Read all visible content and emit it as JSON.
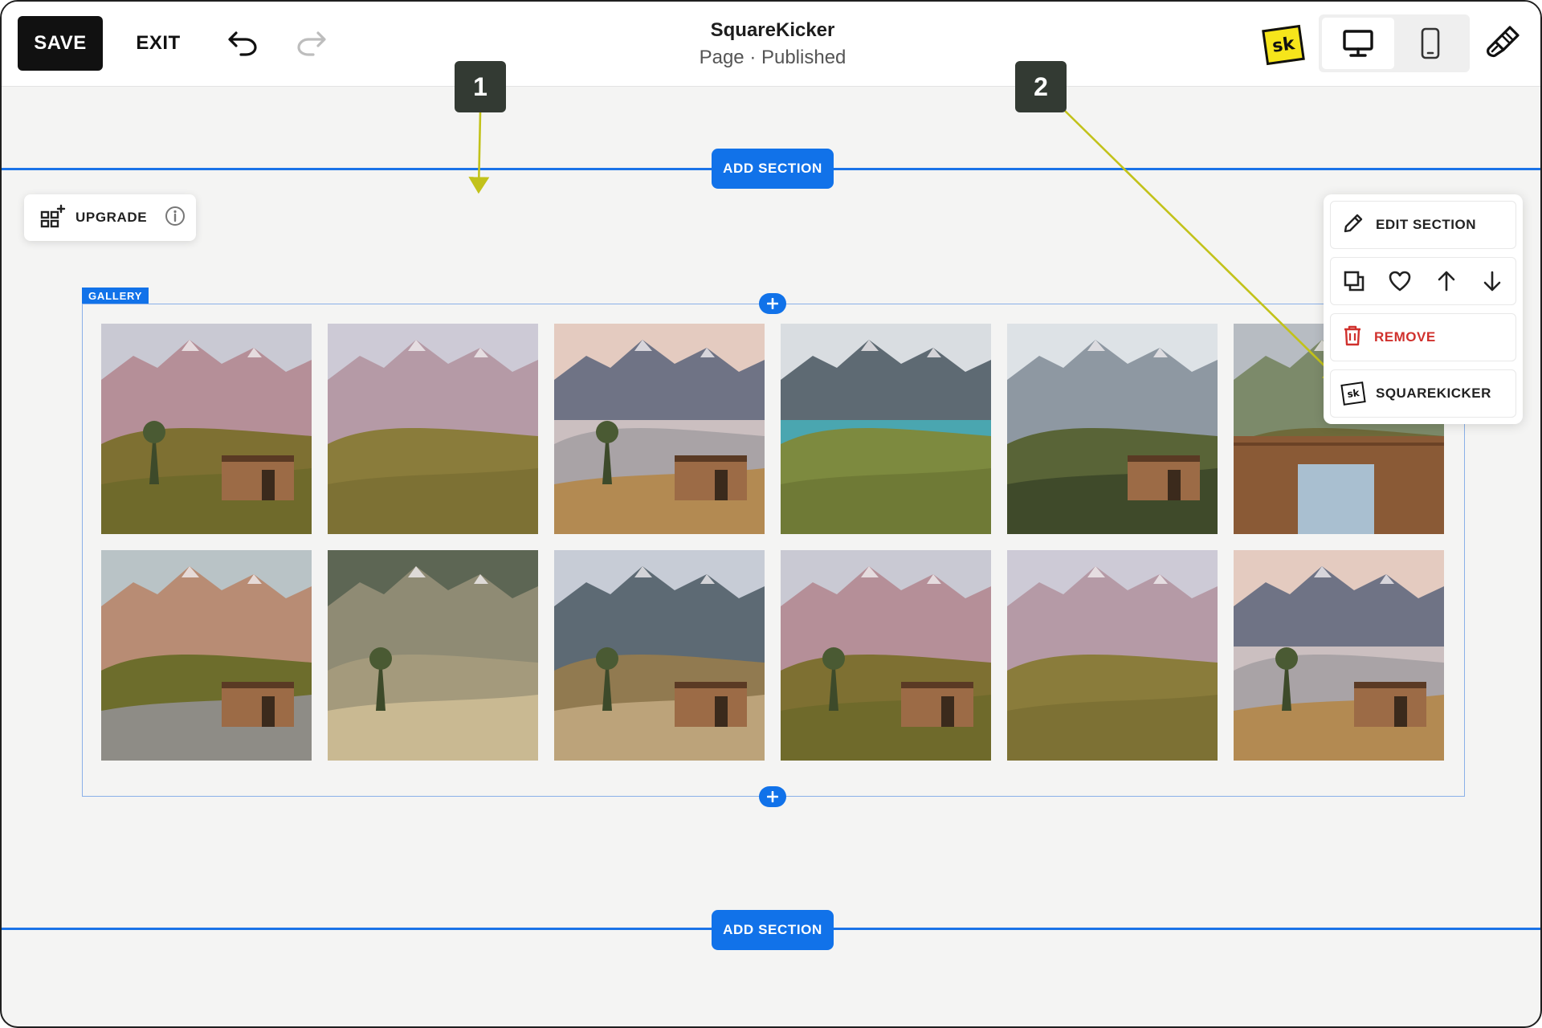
{
  "toolbar": {
    "save_label": "SAVE",
    "exit_label": "EXIT",
    "site_title": "SquareKicker",
    "page_status": "Page · Published",
    "logo_text": "sk",
    "icons": [
      "undo-icon",
      "redo-icon",
      "desktop-icon",
      "mobile-icon",
      "style-brush-icon"
    ]
  },
  "canvas": {
    "add_section_top": "ADD SECTION",
    "add_section_bottom": "ADD SECTION",
    "upgrade_label": "UPGRADE",
    "gallery_tag": "GALLERY",
    "gallery_images": [
      {
        "row": 1,
        "scene": "hillside-cabin"
      },
      {
        "row": 1,
        "scene": "mountain-peaks"
      },
      {
        "row": 1,
        "scene": "lake-cabin"
      },
      {
        "row": 1,
        "scene": "turquoise-lake"
      },
      {
        "row": 1,
        "scene": "snowy-range"
      },
      {
        "row": 1,
        "scene": "cabin-window"
      },
      {
        "row": 2,
        "scene": "cabin-stone-steps"
      },
      {
        "row": 2,
        "scene": "grassy-slope"
      },
      {
        "row": 2,
        "scene": "cabin-meadow"
      },
      {
        "row": 2,
        "scene": "hillside-cabin"
      },
      {
        "row": 2,
        "scene": "mountain-peaks"
      },
      {
        "row": 2,
        "scene": "lake-cabin"
      }
    ]
  },
  "callouts": {
    "one": "1",
    "two": "2",
    "color": "#c2c21a"
  },
  "section_menu": {
    "edit_label": "EDIT SECTION",
    "remove_label": "REMOVE",
    "squarekicker_label": "SQUAREKICKER",
    "sk_badge": "sk",
    "action_icons": [
      "duplicate-icon",
      "heart-icon",
      "arrow-up-icon",
      "arrow-down-icon"
    ]
  },
  "colors": {
    "accent": "#1172e9",
    "remove": "#d0312d",
    "logo_yellow": "#f6e51b"
  }
}
